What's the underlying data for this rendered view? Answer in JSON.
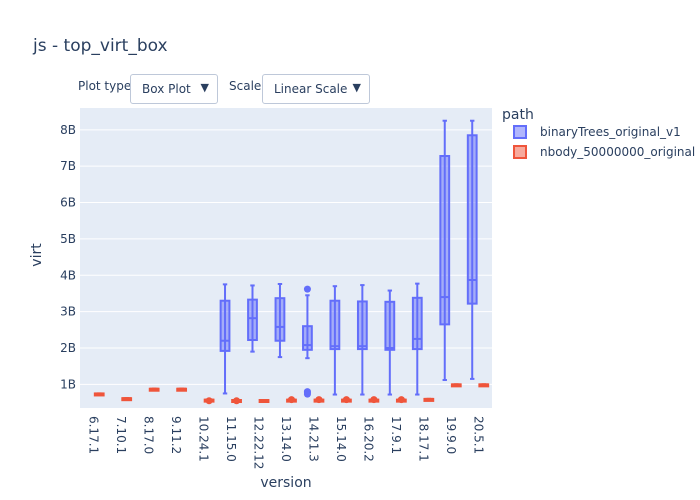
{
  "controls": {
    "plot_type_label": "Plot type:",
    "plot_type_value": "Box Plot",
    "scale_label": "Scale:",
    "scale_value": "Linear Scale",
    "arrow": "▼"
  },
  "colors": {
    "series1_line": "#636efa",
    "series1_fill": "rgba(99,110,250,0.5)",
    "series2_line": "#ef553b",
    "series2_fill": "rgba(239,85,59,0.5)",
    "grid": "#ffffff",
    "plot_bg": "#e5ecf6",
    "text": "#2a3f5f"
  },
  "chart_data": {
    "type": "box",
    "title": "js - top_virt_box",
    "xlabel": "version",
    "ylabel": "virt",
    "ylim": [
      0.35,
      8.6
    ],
    "ytick_values": [
      1,
      2,
      3,
      4,
      5,
      6,
      7,
      8
    ],
    "ytick_labels": [
      "1B",
      "2B",
      "3B",
      "4B",
      "5B",
      "6B",
      "7B",
      "8B"
    ],
    "categories": [
      "6.17.1",
      "7.10.1",
      "8.17.0",
      "9.11.2",
      "10.24.1",
      "11.15.0",
      "12.22.12",
      "13.14.0",
      "14.21.3",
      "15.14.0",
      "16.20.2",
      "17.9.1",
      "18.17.1",
      "19.9.0",
      "20.5.1"
    ],
    "legend_title": "path",
    "legend_position": "top-right outside",
    "series": [
      {
        "name": "binaryTrees_original_v1",
        "boxes": [
          {
            "x": "11.15.0",
            "min": 0.75,
            "q1": 1.92,
            "median": 2.2,
            "q3": 3.3,
            "max": 3.75,
            "outliers": []
          },
          {
            "x": "12.22.12",
            "min": 1.9,
            "q1": 2.22,
            "median": 2.82,
            "q3": 3.33,
            "max": 3.72,
            "outliers": []
          },
          {
            "x": "13.14.0",
            "min": 1.75,
            "q1": 2.2,
            "median": 2.58,
            "q3": 3.37,
            "max": 3.76,
            "outliers": []
          },
          {
            "x": "14.21.3",
            "min": 1.72,
            "q1": 1.95,
            "median": 2.08,
            "q3": 2.6,
            "max": 3.45,
            "outliers": [
              3.62,
              0.8,
              0.77,
              0.73
            ]
          },
          {
            "x": "15.14.0",
            "min": 0.72,
            "q1": 1.97,
            "median": 2.05,
            "q3": 3.3,
            "max": 3.7,
            "outliers": []
          },
          {
            "x": "16.20.2",
            "min": 0.72,
            "q1": 1.97,
            "median": 2.05,
            "q3": 3.28,
            "max": 3.73,
            "outliers": []
          },
          {
            "x": "17.9.1",
            "min": 0.72,
            "q1": 1.95,
            "median": 2.0,
            "q3": 3.27,
            "max": 3.58,
            "outliers": []
          },
          {
            "x": "18.17.1",
            "min": 0.72,
            "q1": 1.97,
            "median": 2.25,
            "q3": 3.38,
            "max": 3.77,
            "outliers": []
          },
          {
            "x": "19.9.0",
            "min": 1.12,
            "q1": 2.65,
            "median": 3.4,
            "q3": 7.28,
            "max": 8.25,
            "outliers": []
          },
          {
            "x": "20.5.1",
            "min": 1.15,
            "q1": 3.22,
            "median": 3.87,
            "q3": 7.85,
            "max": 8.25,
            "outliers": []
          }
        ]
      },
      {
        "name": "nbody_50000000_original",
        "boxes": [
          {
            "x": "6.17.1",
            "min": 0.75,
            "q1": 0.75,
            "median": 0.75,
            "q3": 0.75,
            "max": 0.75,
            "outliers": []
          },
          {
            "x": "7.10.1",
            "min": 0.62,
            "q1": 0.62,
            "median": 0.62,
            "q3": 0.62,
            "max": 0.62,
            "outliers": []
          },
          {
            "x": "8.17.0",
            "min": 0.88,
            "q1": 0.88,
            "median": 0.88,
            "q3": 0.88,
            "max": 0.88,
            "outliers": []
          },
          {
            "x": "9.11.2",
            "min": 0.88,
            "q1": 0.88,
            "median": 0.88,
            "q3": 0.88,
            "max": 0.88,
            "outliers": []
          },
          {
            "x": "10.24.1",
            "min": 0.58,
            "q1": 0.58,
            "median": 0.58,
            "q3": 0.58,
            "max": 0.58,
            "outliers": [
              0.55
            ]
          },
          {
            "x": "11.15.0",
            "min": 0.57,
            "q1": 0.57,
            "median": 0.57,
            "q3": 0.57,
            "max": 0.57,
            "outliers": [
              0.55
            ]
          },
          {
            "x": "12.22.12",
            "min": 0.57,
            "q1": 0.57,
            "median": 0.57,
            "q3": 0.57,
            "max": 0.57,
            "outliers": []
          },
          {
            "x": "13.14.0",
            "min": 0.58,
            "q1": 0.58,
            "median": 0.58,
            "q3": 0.58,
            "max": 0.58,
            "outliers": [
              0.58
            ]
          },
          {
            "x": "14.21.3",
            "min": 0.58,
            "q1": 0.58,
            "median": 0.58,
            "q3": 0.58,
            "max": 0.58,
            "outliers": [
              0.58
            ]
          },
          {
            "x": "15.14.0",
            "min": 0.58,
            "q1": 0.58,
            "median": 0.58,
            "q3": 0.58,
            "max": 0.58,
            "outliers": [
              0.58
            ]
          },
          {
            "x": "16.20.2",
            "min": 0.58,
            "q1": 0.58,
            "median": 0.58,
            "q3": 0.58,
            "max": 0.58,
            "outliers": [
              0.58
            ]
          },
          {
            "x": "17.9.1",
            "min": 0.58,
            "q1": 0.58,
            "median": 0.58,
            "q3": 0.58,
            "max": 0.58,
            "outliers": [
              0.58
            ]
          },
          {
            "x": "18.17.1",
            "min": 0.6,
            "q1": 0.6,
            "median": 0.6,
            "q3": 0.6,
            "max": 0.6,
            "outliers": []
          },
          {
            "x": "19.9.0",
            "min": 1.0,
            "q1": 1.0,
            "median": 1.0,
            "q3": 1.0,
            "max": 1.0,
            "outliers": []
          },
          {
            "x": "20.5.1",
            "min": 1.0,
            "q1": 1.0,
            "median": 1.0,
            "q3": 1.0,
            "max": 1.0,
            "outliers": []
          }
        ]
      }
    ]
  }
}
